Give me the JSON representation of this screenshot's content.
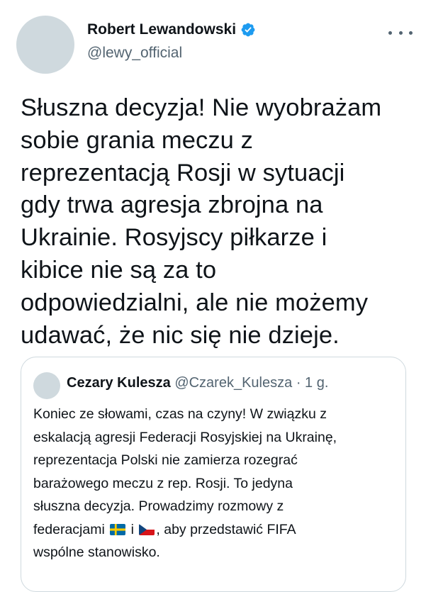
{
  "author": {
    "name": "Robert Lewandowski",
    "handle": "@lewy_official",
    "verified": true
  },
  "tweet": {
    "text": "Słuszna decyzja! Nie wyobrażam\nsobie grania meczu z\nreprezentacją Rosji w sytuacji\ngdy trwa agresja zbrojna na\nUkrainie. Rosyjscy piłkarze i\nkibice nie są za to\nodpowiedzialni, ale nie możemy\nudawać, że nic się nie dzieje."
  },
  "quoted": {
    "name": "Cezary Kulesza",
    "handle": "@Czarek_Kulesza",
    "separator": "·",
    "time": "1 g.",
    "text_line1": "Koniec ze słowami, czas na czyny! W związku z",
    "text_line2": "eskalacją agresji Federacji Rosyjskiej na Ukrainę,",
    "text_line3": "reprezentacja Polski nie zamierza rozegrać",
    "text_line4": "barażowego meczu z rep. Rosji. To jedyna",
    "text_line5": "słuszna decyzja. Prowadzimy rozmowy z",
    "text_line6_a": "federacjami",
    "text_line6_b": "i",
    "text_line6_c": ", aby przedstawić FIFA",
    "text_line7": "wspólne stanowisko.",
    "flags": [
      "sweden-flag",
      "czech-flag"
    ]
  },
  "colors": {
    "text": "#0f1419",
    "secondary": "#536471",
    "border": "#cfd9de",
    "verified": "#1d9bf0"
  }
}
